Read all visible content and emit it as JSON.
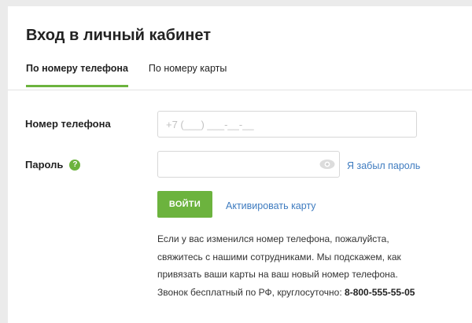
{
  "page": {
    "title": "Вход в личный кабинет"
  },
  "tabs": [
    {
      "label": "По номеру телефона",
      "active": true
    },
    {
      "label": "По номеру карты",
      "active": false
    }
  ],
  "form": {
    "phone_label": "Номер телефона",
    "phone_placeholder": "+7 (___) ___-__-__",
    "phone_value": "",
    "password_label": "Пароль",
    "password_help_icon": "question-icon",
    "password_value": "",
    "password_toggle_icon": "eye-icon",
    "forgot_link": "Я забыл пароль",
    "login_button": "ВОЙТИ",
    "activate_link": "Активировать карту"
  },
  "info": {
    "line1": "Если у вас изменился номер телефона, пожалуйста,",
    "line2": "свяжитесь с нашими сотрудниками. Мы подскажем, как",
    "line3": "привязать ваши карты на ваш новый номер телефона.",
    "line4_prefix": "Звонок бесплатный по РФ, круглосуточно: ",
    "hotline": "8-800-555-55-05"
  },
  "colors": {
    "accent": "#6cb33e",
    "link": "#3f7cc0",
    "background": "#ebebeb"
  }
}
